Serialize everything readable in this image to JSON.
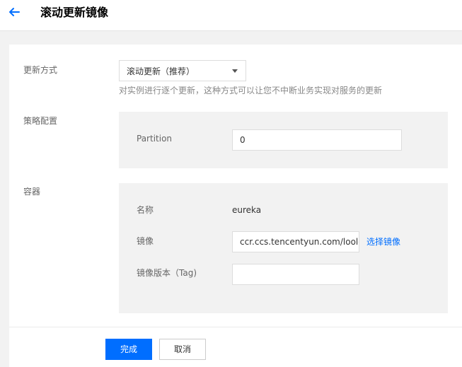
{
  "header": {
    "title": "滚动更新镜像",
    "back_icon": "arrow-left-icon",
    "accent": "#006eff"
  },
  "form": {
    "update_method": {
      "label": "更新方式",
      "selected": "滚动更新（推荐）",
      "hint": "对实例进行逐个更新，这种方式可以让您不中断业务实现对服务的更新"
    },
    "strategy": {
      "label": "策略配置",
      "partition_label": "Partition",
      "partition_value": "0"
    },
    "container": {
      "label": "容器",
      "name_label": "名称",
      "name_value": "eureka",
      "image_label": "镜像",
      "image_value": "ccr.ccs.tencentyun.com/looloo",
      "select_image_link": "选择镜像",
      "tag_label": "镜像版本（Tag)",
      "tag_value": ""
    }
  },
  "footer": {
    "confirm_label": "完成",
    "cancel_label": "取消"
  }
}
